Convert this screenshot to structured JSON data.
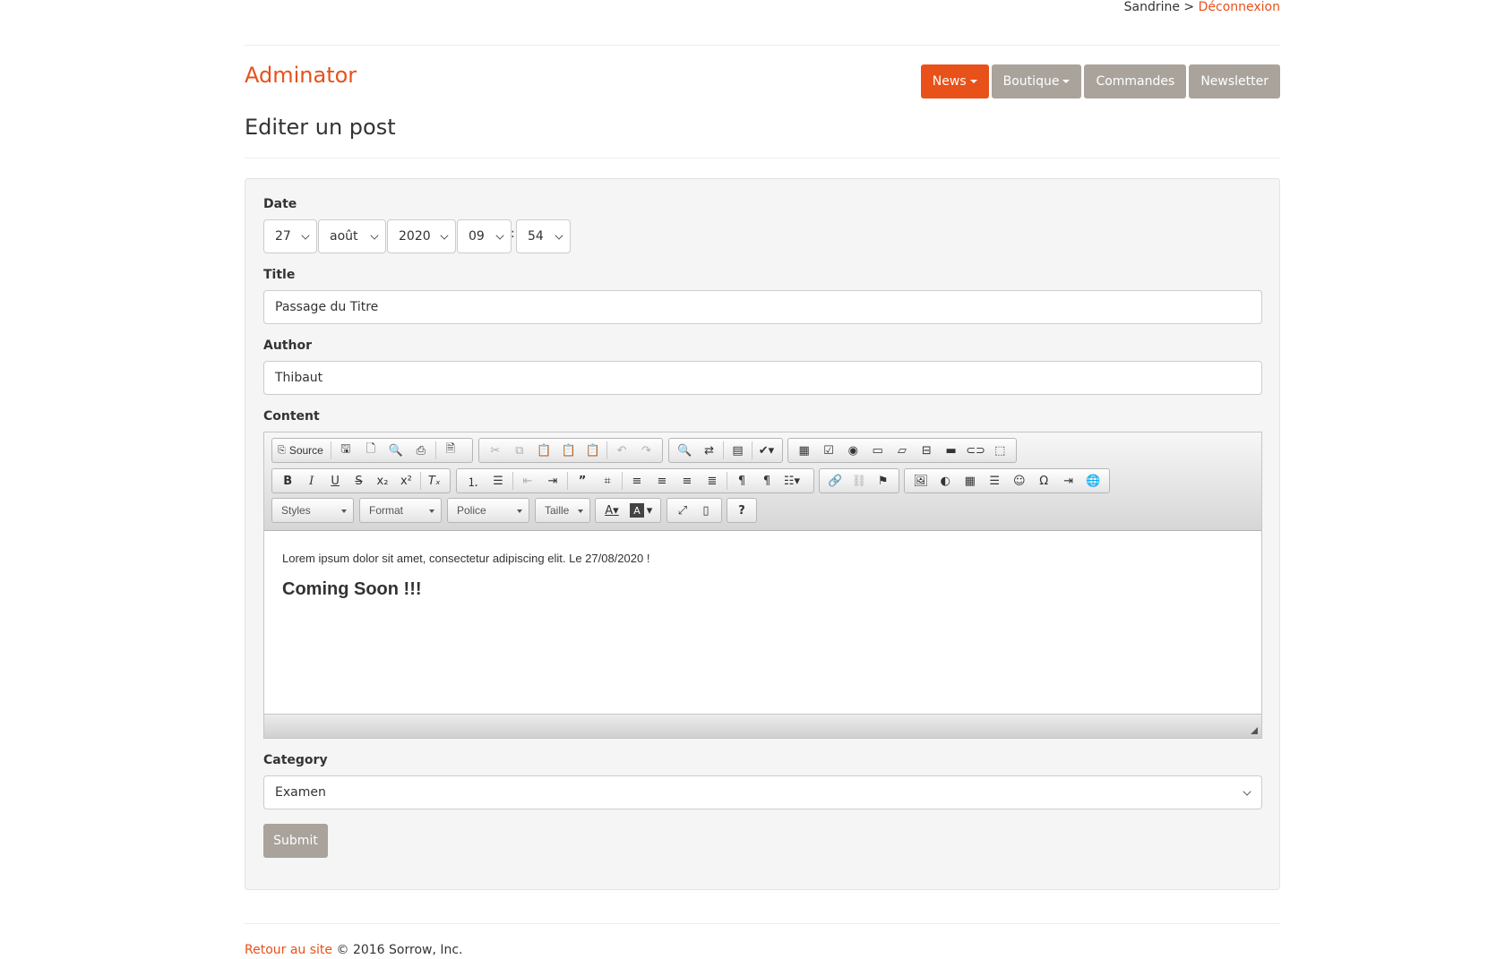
{
  "header": {
    "user": "Sandrine",
    "separator": ">",
    "logout_label": "Déconnexion",
    "brand": "Adminator",
    "nav": [
      {
        "label": "News",
        "active": true,
        "dropdown": true
      },
      {
        "label": "Boutique",
        "active": false,
        "dropdown": true
      },
      {
        "label": "Commandes",
        "active": false,
        "dropdown": false
      },
      {
        "label": "Newsletter",
        "active": false,
        "dropdown": false
      }
    ]
  },
  "page": {
    "title": "Editer un post"
  },
  "form": {
    "date_label": "Date",
    "date": {
      "day": "27",
      "month": "août",
      "year": "2020",
      "hour": "09",
      "minute": "54",
      "time_sep": ":"
    },
    "title_label": "Title",
    "title_value": "Passage du Titre",
    "author_label": "Author",
    "author_value": "Thibaut",
    "content_label": "Content",
    "category_label": "Category",
    "category_value": "Examen",
    "submit_label": "Submit"
  },
  "editor": {
    "source_label": "Source",
    "combos": {
      "styles": "Styles",
      "format": "Format",
      "font": "Police",
      "size": "Taille"
    },
    "content_paragraph": "Lorem ipsum dolor sit amet, consectetur adipiscing elit. Le 27/08/2020 !",
    "content_heading": "Coming Soon !!!"
  },
  "footer": {
    "link_label": "Retour au site",
    "copyright": "© 2016 Sorrow, Inc."
  },
  "colors": {
    "accent": "#e8511a",
    "button_gray": "#a9a39c",
    "panel_bg": "#f5f5f5"
  }
}
